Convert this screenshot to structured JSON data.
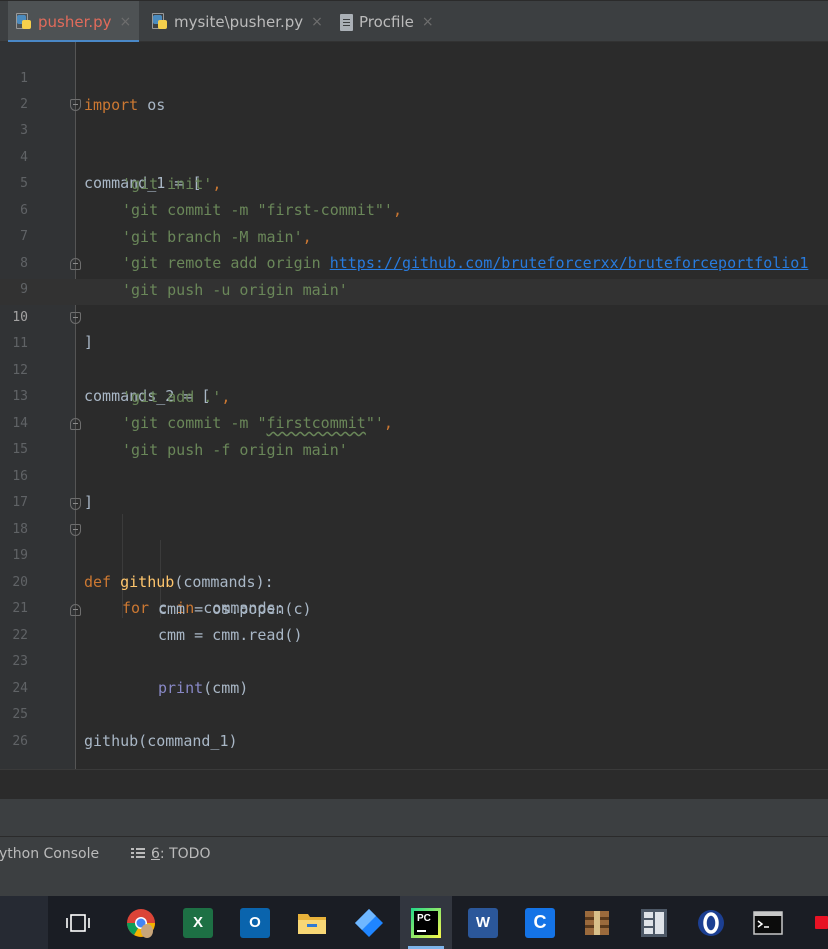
{
  "tabs": [
    {
      "label": "pusher.py",
      "active": true
    },
    {
      "label": "mysite\\pusher.py",
      "active": false
    },
    {
      "label": "Procfile",
      "active": false
    }
  ],
  "close_glyph": "×",
  "editor": {
    "current_line": 10,
    "lines": [
      {
        "n": "1"
      },
      {
        "n": "2"
      },
      {
        "n": "3"
      },
      {
        "n": "4"
      },
      {
        "n": "5"
      },
      {
        "n": "6"
      },
      {
        "n": "7"
      },
      {
        "n": "8"
      },
      {
        "n": "9"
      },
      {
        "n": "10"
      },
      {
        "n": "11"
      },
      {
        "n": "12"
      },
      {
        "n": "13"
      },
      {
        "n": "14"
      },
      {
        "n": "15"
      },
      {
        "n": "16"
      },
      {
        "n": "17"
      },
      {
        "n": "18"
      },
      {
        "n": "19"
      },
      {
        "n": "20"
      },
      {
        "n": "21"
      },
      {
        "n": "22"
      },
      {
        "n": "23"
      },
      {
        "n": "24"
      },
      {
        "n": "25"
      },
      {
        "n": "26"
      }
    ],
    "code": {
      "l1_kw": "import",
      "l1_rest": " os",
      "l3": "command_1 = [",
      "l4_str": "'git init'",
      "l4_comma": ",",
      "l5_str": "'git commit -m \"first-commit\"'",
      "l5_comma": ",",
      "l6_str": "'git branch -M main'",
      "l6_comma": ",",
      "l7_str": "'git remote add origin ",
      "l7_url": "https://github.com/bruteforcerxx/bruteforceportfolio1",
      "l8_str": "'git push -u origin main'",
      "l9": "]",
      "l11": "commands_2 = [",
      "l12_str": "'git add .'",
      "l12_comma": ",",
      "l13_str_a": "'git commit -m \"",
      "l13_typo": "firstcommit",
      "l13_str_b": "\"'",
      "l13_comma": ",",
      "l14_str": "'git push -f origin main'",
      "l15": "]",
      "l18_kw": "def",
      "l18_fn": "github",
      "l18_rest": "(commands):",
      "l19_kw1": "for",
      "l19_c": " c ",
      "l19_kw2": "in",
      "l19_rest": " commands:",
      "l20": "cmm = os.popen(c)",
      "l21": "cmm = cmm.read()",
      "l22_bi": "print",
      "l22_rest": "(cmm)",
      "l25": "github(command_1)"
    }
  },
  "toolwindows": {
    "python_console": "ython Console",
    "todo_num": "6",
    "todo_label": ": TODO"
  },
  "taskbar": {
    "items": [
      {
        "name": "task-view-icon"
      },
      {
        "name": "chrome-icon"
      },
      {
        "name": "excel-icon",
        "letter": "X",
        "color": "#1d7044"
      },
      {
        "name": "outlook-icon",
        "letter": "O",
        "color": "#0a64ad"
      },
      {
        "name": "file-explorer-icon"
      },
      {
        "name": "power-automate-icon"
      },
      {
        "name": "pycharm-icon",
        "letter": "PC",
        "active": true
      },
      {
        "name": "word-icon",
        "letter": "W",
        "color": "#2b579a"
      },
      {
        "name": "c-app-icon",
        "letter": "C",
        "color": "#1473e6"
      },
      {
        "name": "winrar-icon"
      },
      {
        "name": "app-grid-icon"
      },
      {
        "name": "opera-icon"
      },
      {
        "name": "terminal-icon"
      },
      {
        "name": "red-app-icon"
      }
    ]
  }
}
